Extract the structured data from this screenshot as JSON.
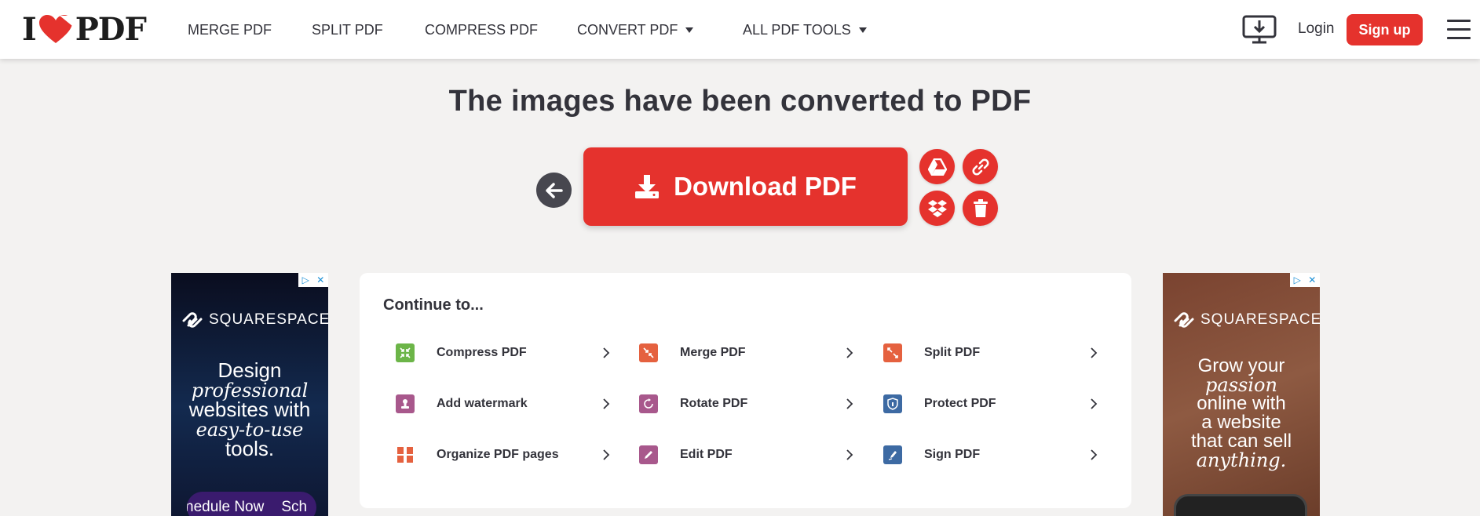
{
  "header": {
    "logo": {
      "left": "I",
      "right": "PDF"
    },
    "nav": [
      {
        "label": "MERGE PDF",
        "has_caret": false
      },
      {
        "label": "SPLIT PDF",
        "has_caret": false
      },
      {
        "label": "COMPRESS PDF",
        "has_caret": false
      },
      {
        "label": "CONVERT PDF",
        "has_caret": true
      },
      {
        "label": "ALL PDF TOOLS",
        "has_caret": true
      }
    ],
    "login_label": "Login",
    "signup_label": "Sign up"
  },
  "main": {
    "title": "The images have been converted to PDF",
    "download_label": "Download PDF"
  },
  "continue": {
    "title": "Continue to...",
    "tools": [
      {
        "label": "Compress PDF",
        "icon": "compress-icon",
        "color": "#6cb548"
      },
      {
        "label": "Merge PDF",
        "icon": "merge-icon",
        "color": "#e5613f"
      },
      {
        "label": "Split PDF",
        "icon": "split-icon",
        "color": "#e5613f"
      },
      {
        "label": "Add watermark",
        "icon": "watermark-icon",
        "color": "#a8588c"
      },
      {
        "label": "Rotate PDF",
        "icon": "rotate-icon",
        "color": "#a8588c"
      },
      {
        "label": "Protect PDF",
        "icon": "shield-icon",
        "color": "#3d6aa3"
      },
      {
        "label": "Organize PDF pages",
        "icon": "organize-icon",
        "color": "#e5613f"
      },
      {
        "label": "Edit PDF",
        "icon": "pencil-icon",
        "color": "#a8588c"
      },
      {
        "label": "Sign PDF",
        "icon": "sign-icon",
        "color": "#3d6aa3"
      }
    ]
  },
  "ads": {
    "left": {
      "brand": "SQUARESPACE",
      "lines": [
        "Design",
        "professional",
        "websites with",
        "easy-to-use",
        "tools."
      ],
      "cta": "hedule Now",
      "cta_italic": "Now",
      "cta_extra": "Sch"
    },
    "right": {
      "brand": "SQUARESPACE",
      "lines": [
        "Grow your",
        "passion",
        "online with",
        "a website",
        "that can sell",
        "anything."
      ]
    }
  },
  "colors": {
    "brand_red": "#e5322d",
    "text": "#33333b",
    "background": "#f3f2f1"
  }
}
